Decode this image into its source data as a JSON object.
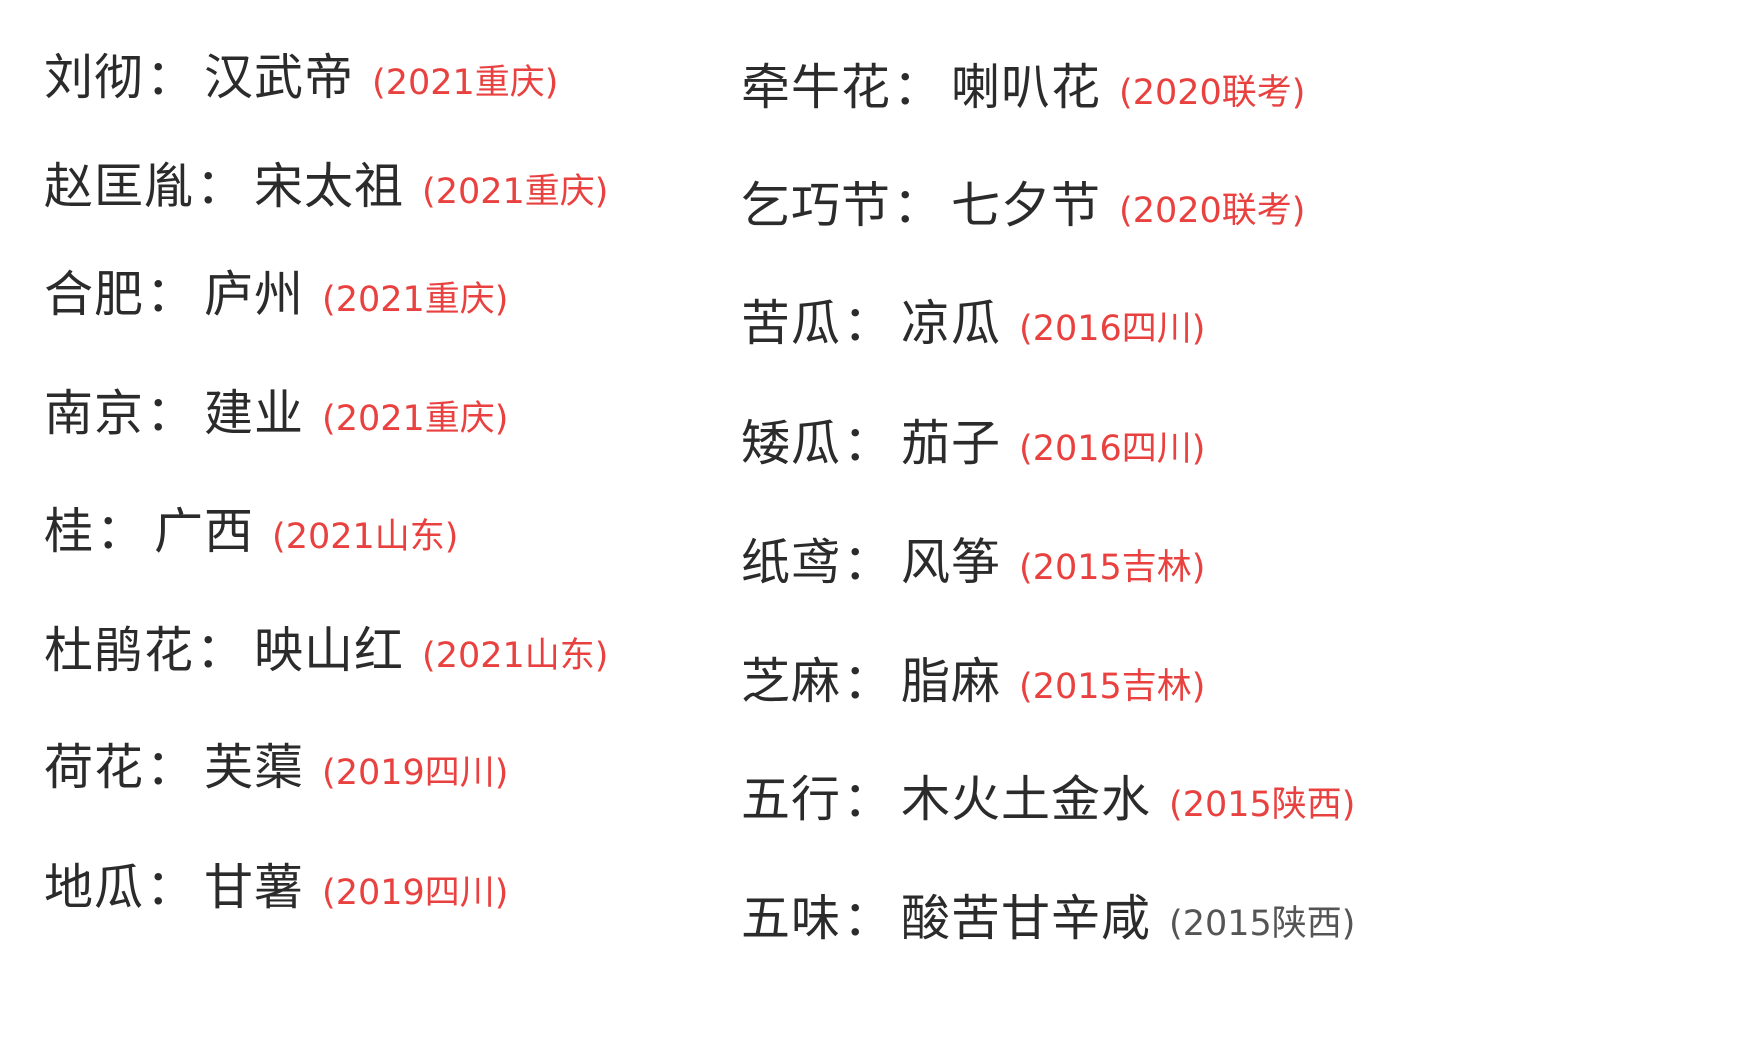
{
  "separator": "：",
  "left_column": [
    {
      "term": "刘彻",
      "answer": "汉武帝",
      "source": "(2021重庆)"
    },
    {
      "term": "赵匡胤",
      "answer": "宋太祖",
      "source": "(2021重庆)"
    },
    {
      "term": "合肥",
      "answer": "庐州",
      "source": "(2021重庆)"
    },
    {
      "term": "南京",
      "answer": "建业",
      "source": "(2021重庆)"
    },
    {
      "term": "桂",
      "answer": "广西",
      "source": "(2021山东)"
    },
    {
      "term": "杜鹃花",
      "answer": "映山红",
      "source": "(2021山东)"
    },
    {
      "term": "荷花",
      "answer": "芙蕖",
      "source": "(2019四川)"
    },
    {
      "term": "地瓜",
      "answer": "甘薯",
      "source": "(2019四川)"
    }
  ],
  "right_column": [
    {
      "term": "牵牛花",
      "answer": "喇叭花",
      "source": "(2020联考)"
    },
    {
      "term": "乞巧节",
      "answer": "七夕节",
      "source": "(2020联考)"
    },
    {
      "term": "苦瓜",
      "answer": "凉瓜",
      "source": "(2016四川)"
    },
    {
      "term": "矮瓜",
      "answer": "茄子",
      "source": "(2016四川)"
    },
    {
      "term": "纸鸢",
      "answer": "风筝",
      "source": "(2015吉林)"
    },
    {
      "term": "芝麻",
      "answer": "脂麻",
      "source": "(2015吉林)"
    },
    {
      "term": "五行",
      "answer": "木火土金水",
      "source": "(2015陕西)"
    },
    {
      "term": "五味",
      "answer": "酸苦甘辛咸",
      "source": "(2015陕西)",
      "source_color": "#555555"
    }
  ],
  "colors": {
    "text": "#2b2b2b",
    "source": "#e8413f",
    "background": "#ffffff"
  }
}
